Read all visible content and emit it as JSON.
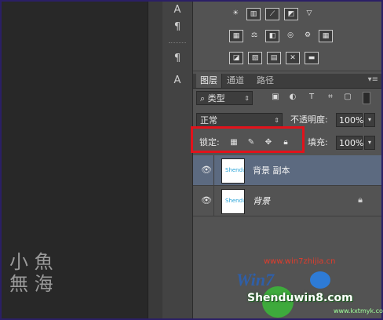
{
  "tabs": [
    {
      "label": "图层",
      "active": true
    },
    {
      "label": "通道",
      "active": false
    },
    {
      "label": "路径",
      "active": false
    }
  ],
  "filter": {
    "kind_label": "类型"
  },
  "blend": {
    "mode": "正常",
    "opacity_label": "不透明度:",
    "opacity_value": "100%"
  },
  "lock": {
    "label": "锁定:",
    "fill_label": "填充:",
    "fill_value": "100%"
  },
  "layers": [
    {
      "name": "背景 副本",
      "selected": true,
      "locked": false,
      "thumb_text": "Shendu"
    },
    {
      "name": "背景",
      "selected": false,
      "locked": true,
      "thumb_text": "Shendu"
    }
  ],
  "watermark": {
    "url": "www.win7zhijia.cn",
    "brand": "Win7",
    "site": "Shenduwin8.com",
    "sub": "www.kxtmyk.com",
    "corner_line1": "小 魚",
    "corner_line2": "無 海"
  },
  "colors": {
    "highlight_box": "#e2121b",
    "selected_layer": "#5c6a80"
  }
}
